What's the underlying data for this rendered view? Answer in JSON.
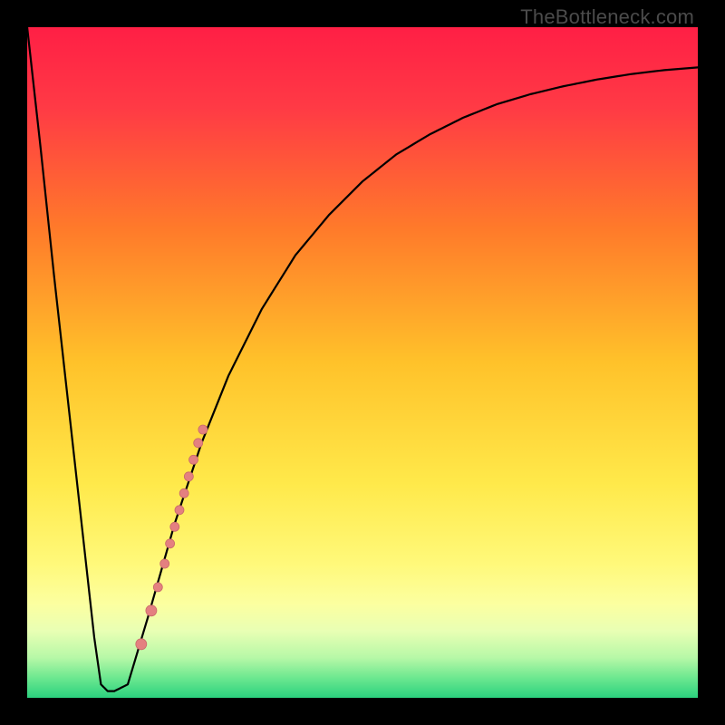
{
  "watermark": "TheBottleneck.com",
  "colors": {
    "black": "#000000",
    "curve": "#000000",
    "dot_fill": "#e48080",
    "dot_stroke": "#c96a6a",
    "gradient_stops": [
      {
        "offset": 0.0,
        "color": "#ff1f45"
      },
      {
        "offset": 0.12,
        "color": "#ff3a45"
      },
      {
        "offset": 0.3,
        "color": "#ff7a2a"
      },
      {
        "offset": 0.5,
        "color": "#ffc22a"
      },
      {
        "offset": 0.68,
        "color": "#ffe94a"
      },
      {
        "offset": 0.8,
        "color": "#fff97a"
      },
      {
        "offset": 0.86,
        "color": "#fcffa0"
      },
      {
        "offset": 0.9,
        "color": "#e9ffb4"
      },
      {
        "offset": 0.94,
        "color": "#b7f8a7"
      },
      {
        "offset": 0.97,
        "color": "#6de890"
      },
      {
        "offset": 1.0,
        "color": "#2bd17e"
      }
    ]
  },
  "chart_data": {
    "type": "line",
    "title": "",
    "xlabel": "",
    "ylabel": "",
    "xlim": [
      0,
      100
    ],
    "ylim": [
      0,
      100
    ],
    "grid": false,
    "legend": false,
    "series": [
      {
        "name": "bottleneck-curve",
        "x": [
          0,
          2,
          4,
          6,
          8,
          10,
          11,
          12,
          13,
          15,
          18,
          22,
          26,
          30,
          35,
          40,
          45,
          50,
          55,
          60,
          65,
          70,
          75,
          80,
          85,
          90,
          95,
          100
        ],
        "y": [
          100,
          82,
          63,
          45,
          27,
          9,
          2,
          1,
          1,
          2,
          12,
          26,
          38,
          48,
          58,
          66,
          72,
          77,
          81,
          84,
          86.5,
          88.5,
          90,
          91.2,
          92.2,
          93,
          93.6,
          94
        ]
      }
    ],
    "flat_bottom": {
      "x_start": 11,
      "x_end": 13,
      "y": 1
    },
    "dots": [
      {
        "x": 17.0,
        "y": 8.0,
        "r": 6
      },
      {
        "x": 18.5,
        "y": 13.0,
        "r": 6
      },
      {
        "x": 19.5,
        "y": 16.5,
        "r": 5
      },
      {
        "x": 20.5,
        "y": 20.0,
        "r": 5
      },
      {
        "x": 21.3,
        "y": 23.0,
        "r": 5
      },
      {
        "x": 22.0,
        "y": 25.5,
        "r": 5
      },
      {
        "x": 22.7,
        "y": 28.0,
        "r": 5
      },
      {
        "x": 23.4,
        "y": 30.5,
        "r": 5
      },
      {
        "x": 24.1,
        "y": 33.0,
        "r": 5
      },
      {
        "x": 24.8,
        "y": 35.5,
        "r": 5
      },
      {
        "x": 25.5,
        "y": 38.0,
        "r": 5
      },
      {
        "x": 26.2,
        "y": 40.0,
        "r": 5
      }
    ]
  }
}
